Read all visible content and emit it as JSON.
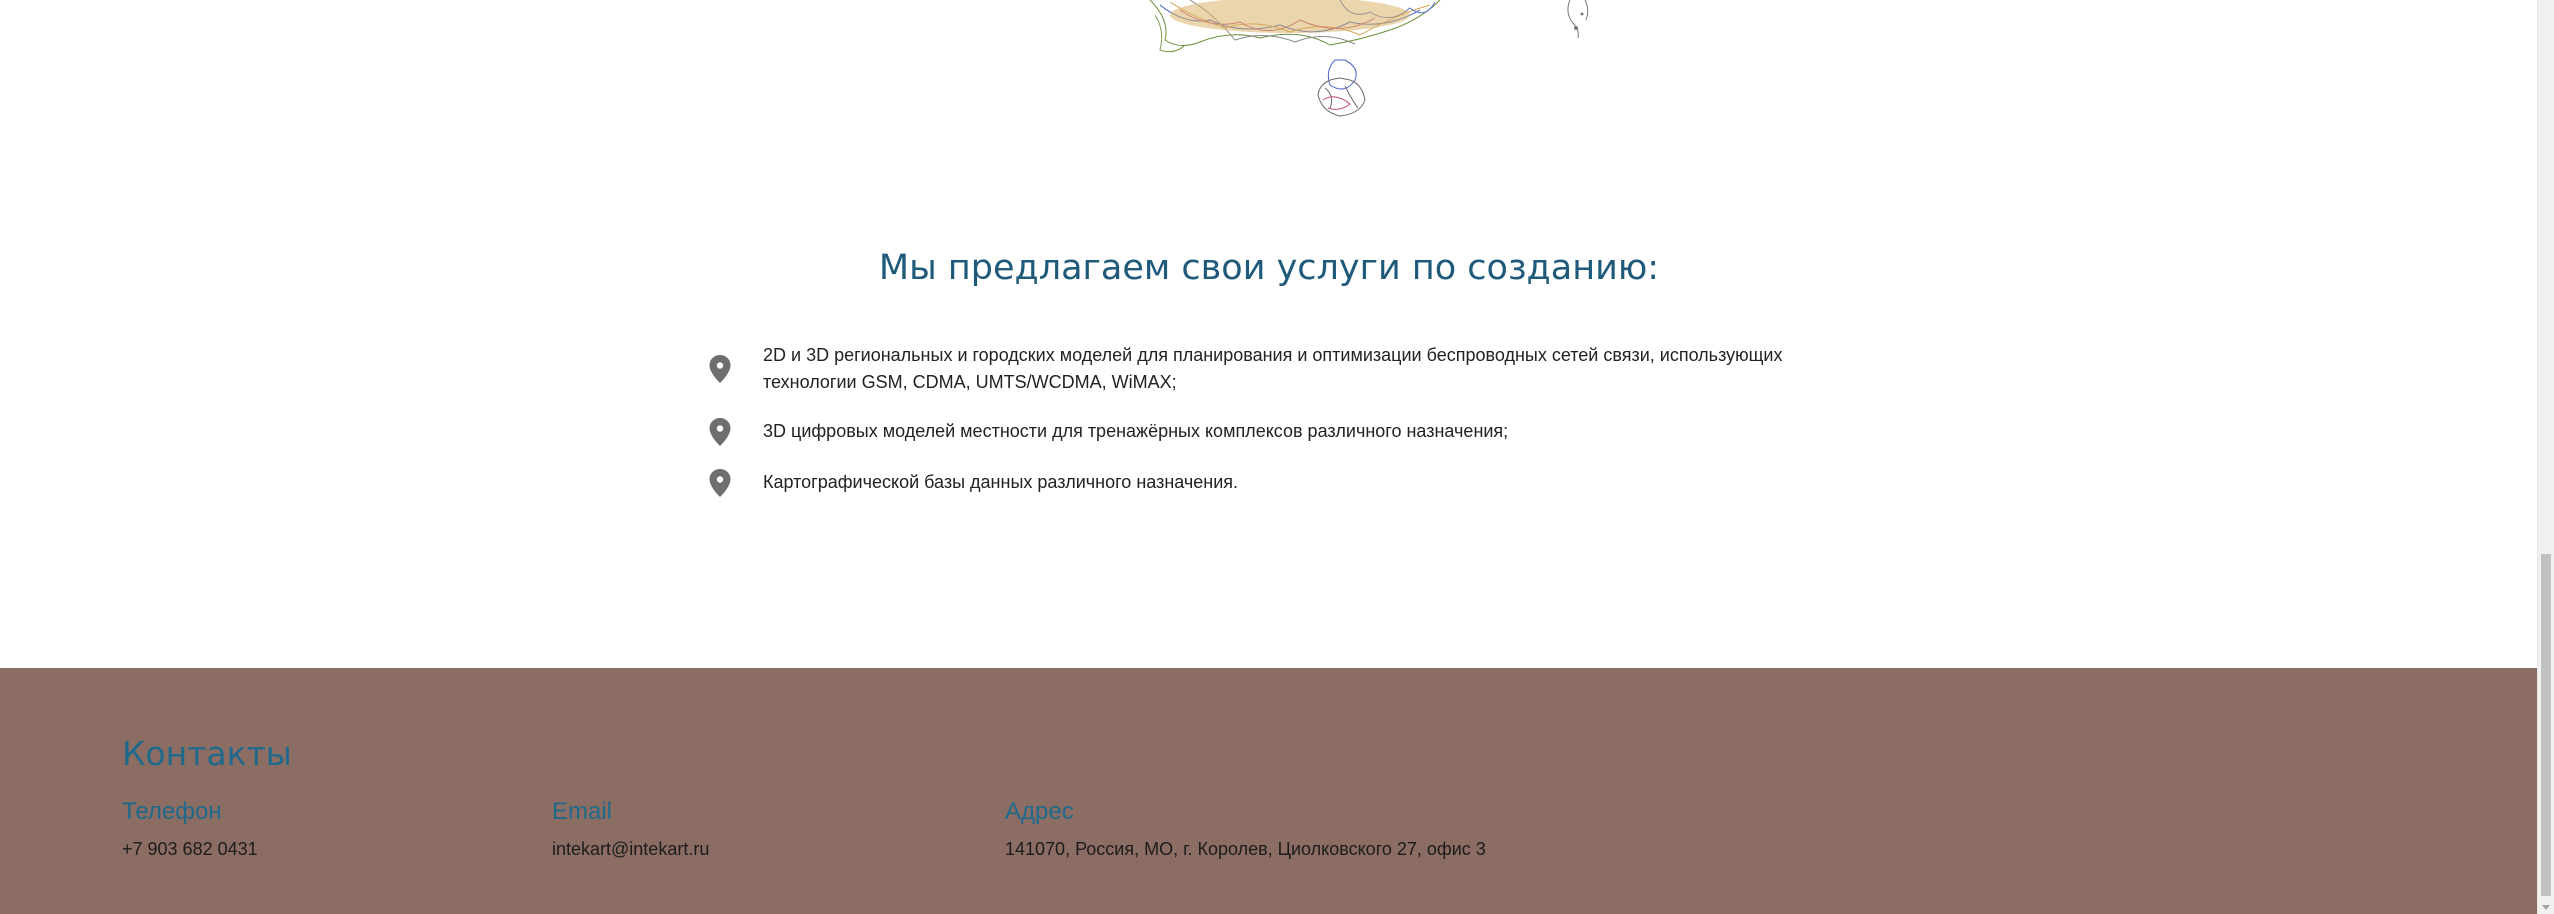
{
  "services": {
    "title": "Мы предлагаем свои услуги по созданию:",
    "items": [
      "2D и 3D региональных и городских моделей для планирования и оптимизации беспроводных сетей связи, использующих технологии GSM, CDMA, UMTS/WCDMA, WiMAX;",
      "3D цифровых моделей местности для тренажёрных комплексов различного назначения;",
      "Картографической базы данных различного назначения."
    ],
    "pin_icon": "map-pin-icon",
    "title_color": "#1f5a7a"
  },
  "footer": {
    "title": "Контакты",
    "background": "#8b6d63",
    "accent": "#1f6a8c",
    "phone": {
      "label": "Телефон",
      "value": "+7 903 682 0431"
    },
    "email": {
      "label": "Email",
      "value": "intekart@intekart.ru"
    },
    "address": {
      "label": "Адрес",
      "value": "141070, Россия, МО, г. Королев, Циолковского 27, офис 3"
    }
  }
}
